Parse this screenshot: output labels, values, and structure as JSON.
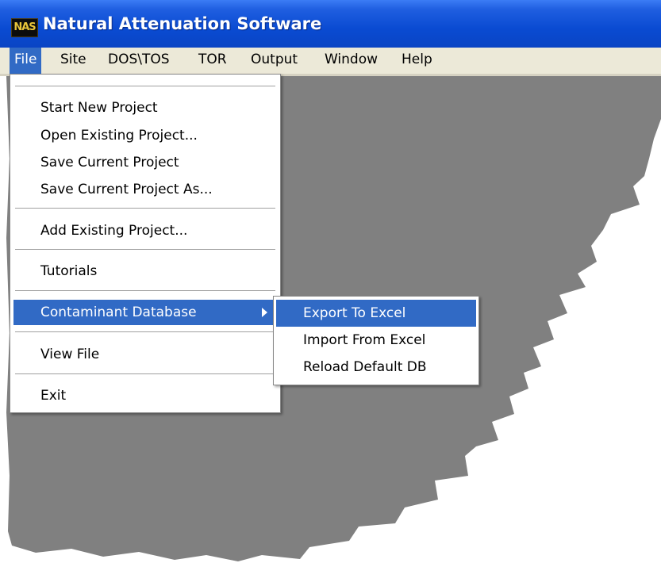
{
  "app": {
    "title": "Natural Attenuation Software",
    "icon_text": "NAS",
    "icon": "nas-app-icon"
  },
  "menubar": {
    "items": [
      {
        "label": "File",
        "active": true
      },
      {
        "label": "Site"
      },
      {
        "label": "DOS\\TOS"
      },
      {
        "label": "TOR"
      },
      {
        "label": "Output"
      },
      {
        "label": "Window"
      },
      {
        "label": "Help"
      }
    ]
  },
  "file_menu": {
    "items": [
      {
        "label": "Start New Project"
      },
      {
        "label": "Open Existing Project..."
      },
      {
        "label": "Save Current Project"
      },
      {
        "label": "Save Current Project As..."
      },
      {
        "label": "Add Existing Project..."
      },
      {
        "label": "Tutorials"
      },
      {
        "label": "Contaminant Database",
        "selected": true,
        "submenu_icon": "submenu-arrow-icon"
      },
      {
        "label": "View File"
      },
      {
        "label": "Exit"
      }
    ]
  },
  "submenu": {
    "items": [
      {
        "label": "Export To Excel",
        "selected": true
      },
      {
        "label": "Import From Excel"
      },
      {
        "label": "Reload Default DB"
      }
    ]
  },
  "colors": {
    "titlebar": "#0a4bd2",
    "menubar": "#ece9d8",
    "highlight": "#316ac5",
    "workspace": "#808080"
  }
}
